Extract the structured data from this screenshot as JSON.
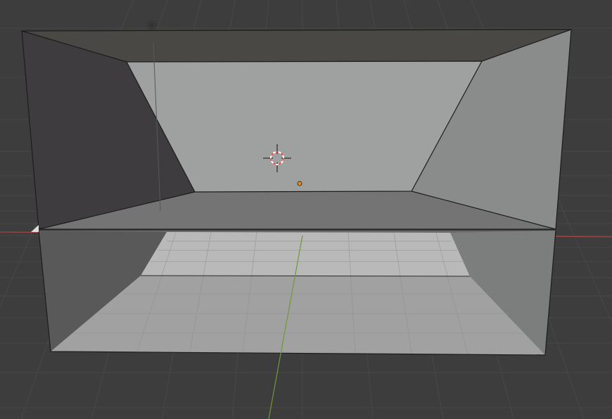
{
  "viewport": {
    "background_color": "#3d3d3d",
    "grid_color": "#4a4a4a",
    "x_axis_color": "#b34a4a",
    "y_axis_color": "#6e9a3a"
  },
  "scene": {
    "mesh_colors": {
      "back_wall": "#9fa1a0",
      "left_wall": "#3e3c3e",
      "right_wall": "#8a8c8b",
      "ceiling": "#4a4845",
      "floor_upper": "#747475",
      "floor_reflection": "#a9aaa9",
      "edge": "#1c1c1c"
    },
    "icons": {
      "cursor": "3d-cursor-icon",
      "light": "light-icon",
      "origin": "object-origin-icon"
    },
    "cursor_colors": {
      "ring_red": "#e0504a",
      "ring_white": "#ffffff",
      "crosshair": "#111111"
    },
    "origin_color": "#e88a1a"
  }
}
